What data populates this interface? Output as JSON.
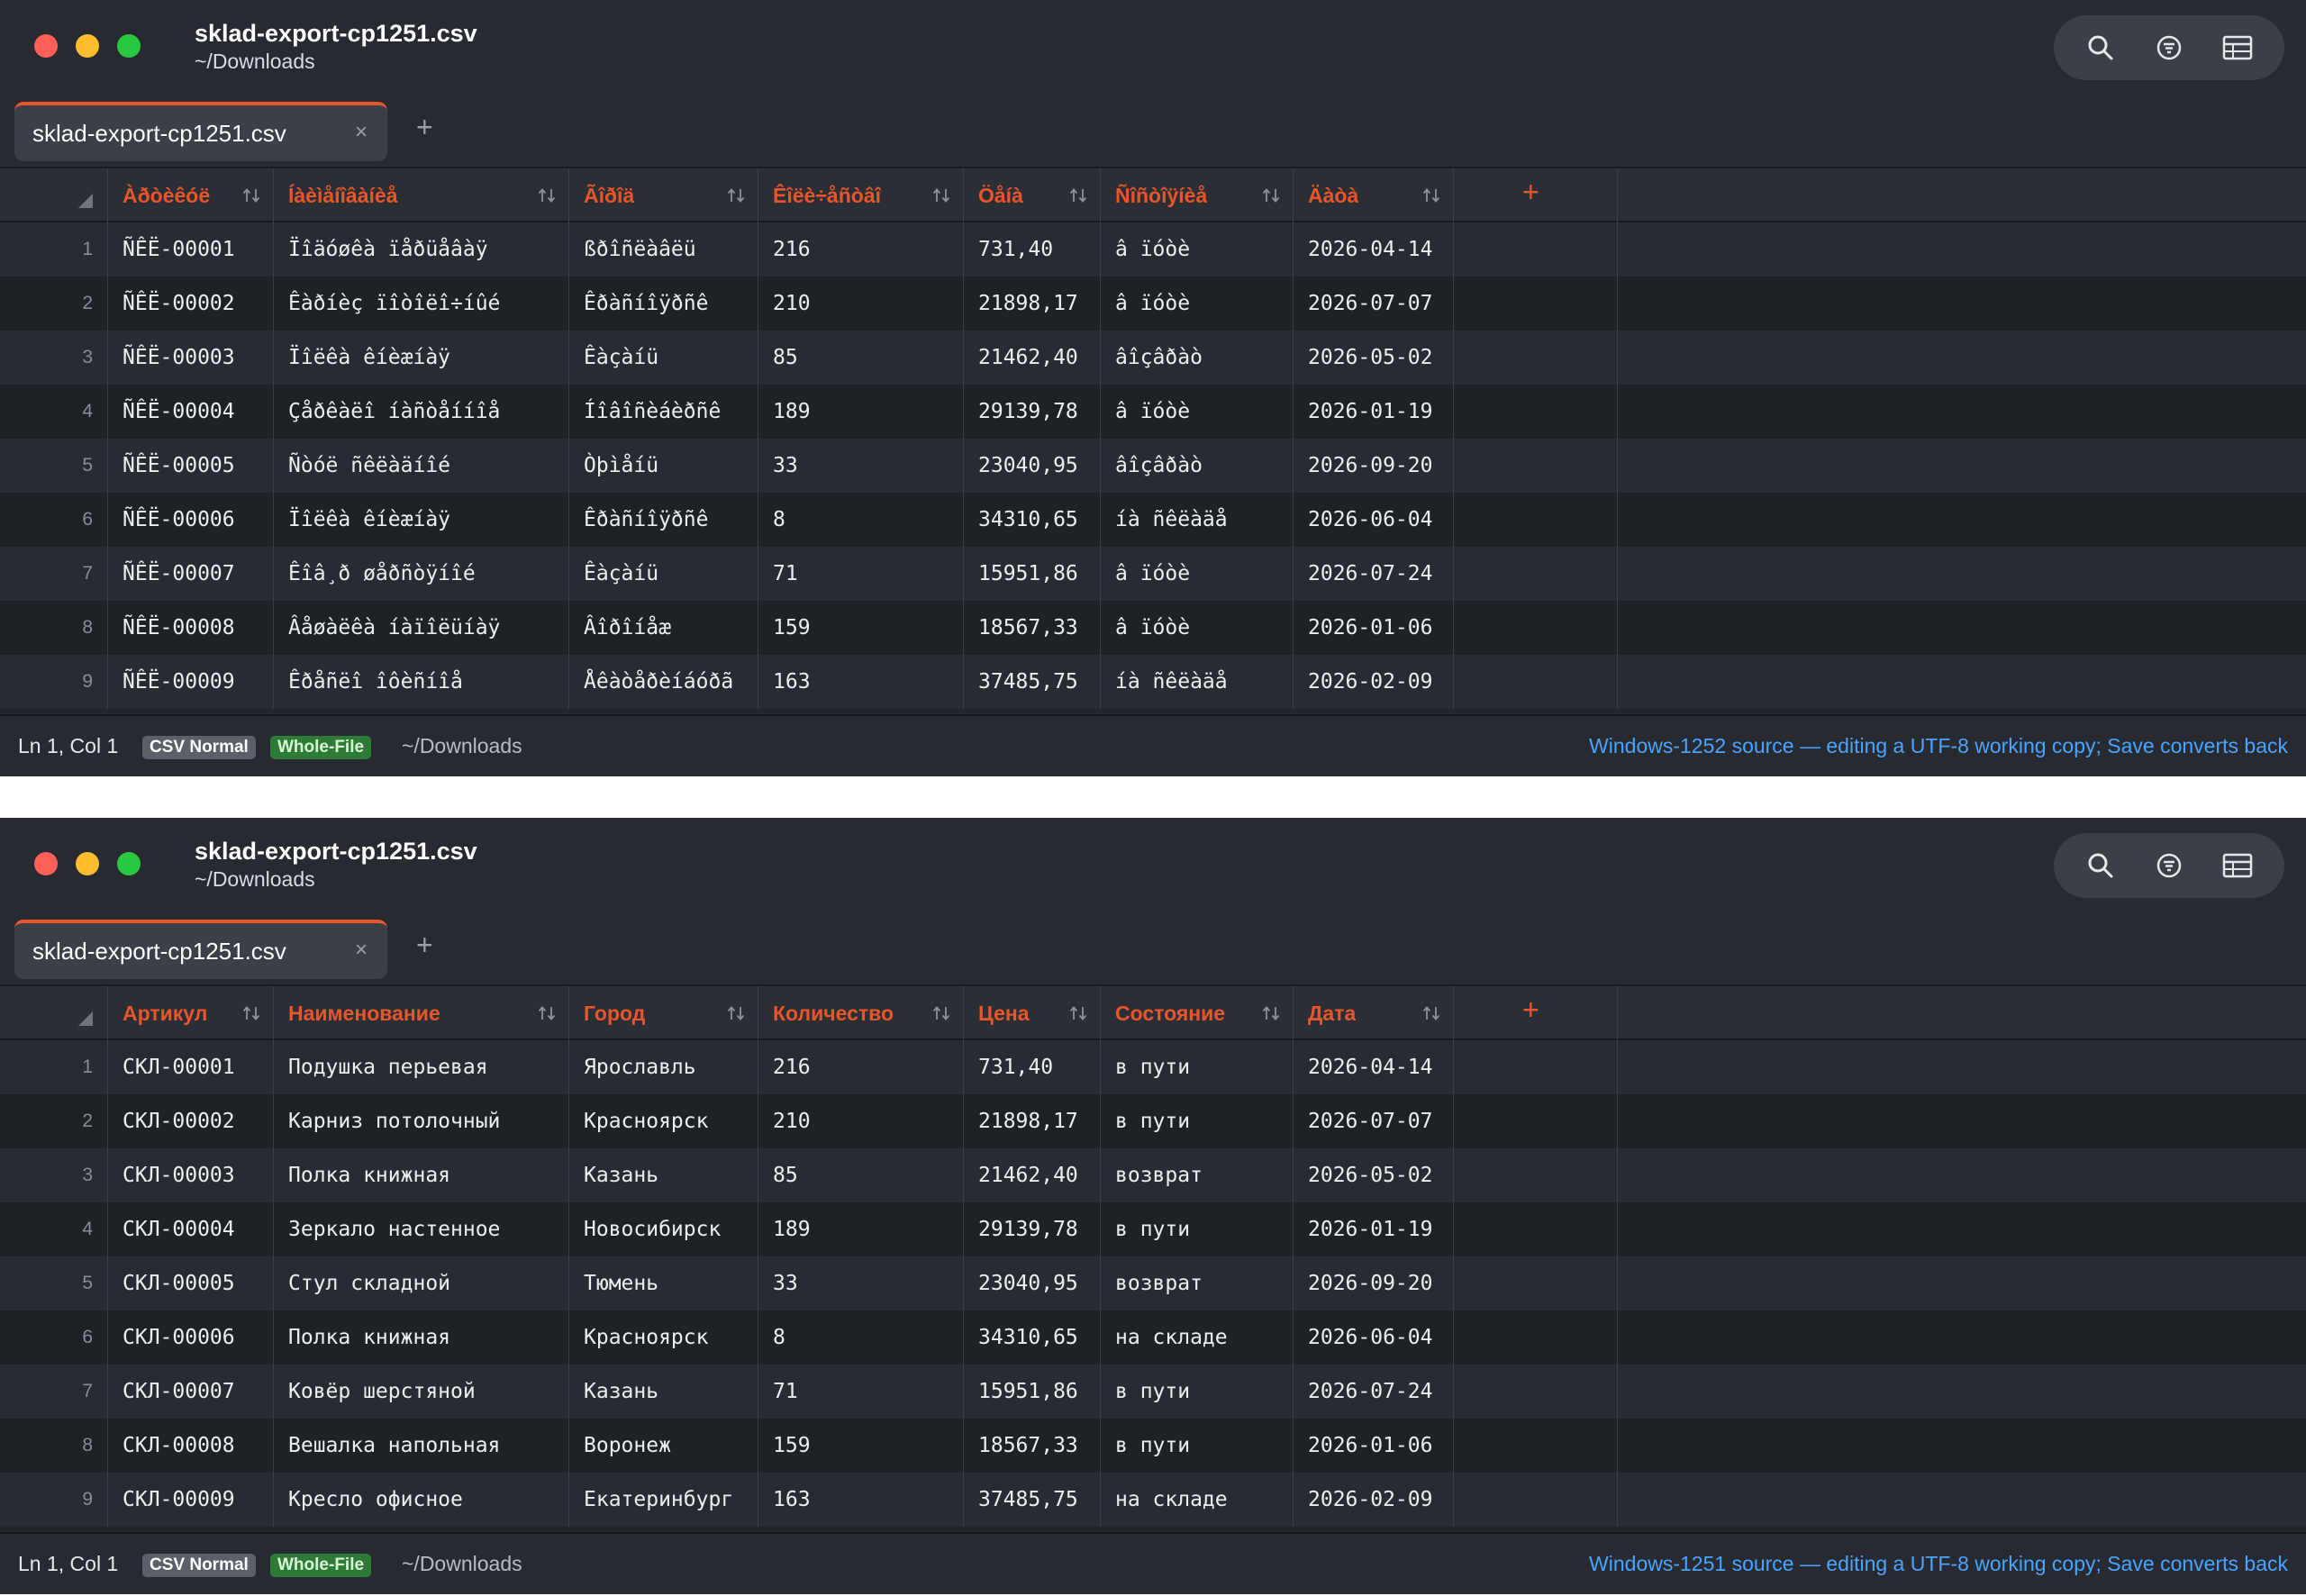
{
  "windows": [
    {
      "title": "sklad-export-cp1251.csv",
      "subtitle": "~/Downloads",
      "tab_label": "sklad-export-cp1251.csv",
      "tab_close": "×",
      "tab_add": "+",
      "col_add": "+",
      "tools": [
        "search-icon",
        "filter-icon",
        "table-icon"
      ],
      "headers": [
        "Àðòèêóë",
        "Íàèìåíîâàíèå",
        "Ãîðîä",
        "Êîëè÷åñòâî",
        "Öåíà",
        "Ñîñòîÿíèå",
        "Äàòà"
      ],
      "rows": [
        [
          "ÑÊË-00001",
          "Ïîäóøêà ïåðüåâàÿ",
          "ßðîñëàâëü",
          "216",
          "731,40",
          "â ïóòè",
          "2026-04-14"
        ],
        [
          "ÑÊË-00002",
          "Êàðíèç ïîòîëî÷íûé",
          "Êðàñíîÿðñê",
          "210",
          "21898,17",
          "â ïóòè",
          "2026-07-07"
        ],
        [
          "ÑÊË-00003",
          "Ïîëêà êíèæíàÿ",
          "Êàçàíü",
          "85",
          "21462,40",
          "âîçâðàò",
          "2026-05-02"
        ],
        [
          "ÑÊË-00004",
          "Çåðêàëî íàñòåííîå",
          "Íîâîñèáèðñê",
          "189",
          "29139,78",
          "â ïóòè",
          "2026-01-19"
        ],
        [
          "ÑÊË-00005",
          "Ñòóë ñêëàäíîé",
          "Òþìåíü",
          "33",
          "23040,95",
          "âîçâðàò",
          "2026-09-20"
        ],
        [
          "ÑÊË-00006",
          "Ïîëêà êíèæíàÿ",
          "Êðàñíîÿðñê",
          "8",
          "34310,65",
          "íà ñêëàäå",
          "2026-06-04"
        ],
        [
          "ÑÊË-00007",
          "Êîâ¸ð øåðñòÿíîé",
          "Êàçàíü",
          "71",
          "15951,86",
          "â ïóòè",
          "2026-07-24"
        ],
        [
          "ÑÊË-00008",
          "Âåøàëêà íàïîëüíàÿ",
          "Âîðîíåæ",
          "159",
          "18567,33",
          "â ïóòè",
          "2026-01-06"
        ],
        [
          "ÑÊË-00009",
          "Êðåñëî îôèñíîå",
          "Åêàòåðèíáóðã",
          "163",
          "37485,75",
          "íà ñêëàäå",
          "2026-02-09"
        ]
      ],
      "status": {
        "position": "Ln 1, Col 1",
        "mode_badge": "CSV Normal",
        "scope_badge": "Whole-File",
        "path": "~/Downloads",
        "note": "Windows-1252 source — editing a UTF-8 working copy; Save converts back"
      }
    },
    {
      "title": "sklad-export-cp1251.csv",
      "subtitle": "~/Downloads",
      "tab_label": "sklad-export-cp1251.csv",
      "tab_close": "×",
      "tab_add": "+",
      "col_add": "+",
      "tools": [
        "search-icon",
        "filter-icon",
        "table-icon"
      ],
      "headers": [
        "Артикул",
        "Наименование",
        "Город",
        "Количество",
        "Цена",
        "Состояние",
        "Дата"
      ],
      "rows": [
        [
          "СКЛ-00001",
          "Подушка перьевая",
          "Ярославль",
          "216",
          "731,40",
          "в пути",
          "2026-04-14"
        ],
        [
          "СКЛ-00002",
          "Карниз потолочный",
          "Красноярск",
          "210",
          "21898,17",
          "в пути",
          "2026-07-07"
        ],
        [
          "СКЛ-00003",
          "Полка книжная",
          "Казань",
          "85",
          "21462,40",
          "возврат",
          "2026-05-02"
        ],
        [
          "СКЛ-00004",
          "Зеркало настенное",
          "Новосибирск",
          "189",
          "29139,78",
          "в пути",
          "2026-01-19"
        ],
        [
          "СКЛ-00005",
          "Стул складной",
          "Тюмень",
          "33",
          "23040,95",
          "возврат",
          "2026-09-20"
        ],
        [
          "СКЛ-00006",
          "Полка книжная",
          "Красноярск",
          "8",
          "34310,65",
          "на складе",
          "2026-06-04"
        ],
        [
          "СКЛ-00007",
          "Ковёр шерстяной",
          "Казань",
          "71",
          "15951,86",
          "в пути",
          "2026-07-24"
        ],
        [
          "СКЛ-00008",
          "Вешалка напольная",
          "Воронеж",
          "159",
          "18567,33",
          "в пути",
          "2026-01-06"
        ],
        [
          "СКЛ-00009",
          "Кресло офисное",
          "Екатеринбург",
          "163",
          "37485,75",
          "на складе",
          "2026-02-09"
        ]
      ],
      "status": {
        "position": "Ln 1, Col 1",
        "mode_badge": "CSV Normal",
        "scope_badge": "Whole-File",
        "path": "~/Downloads",
        "note": "Windows-1251 source — editing a UTF-8 working copy; Save converts back"
      }
    }
  ]
}
